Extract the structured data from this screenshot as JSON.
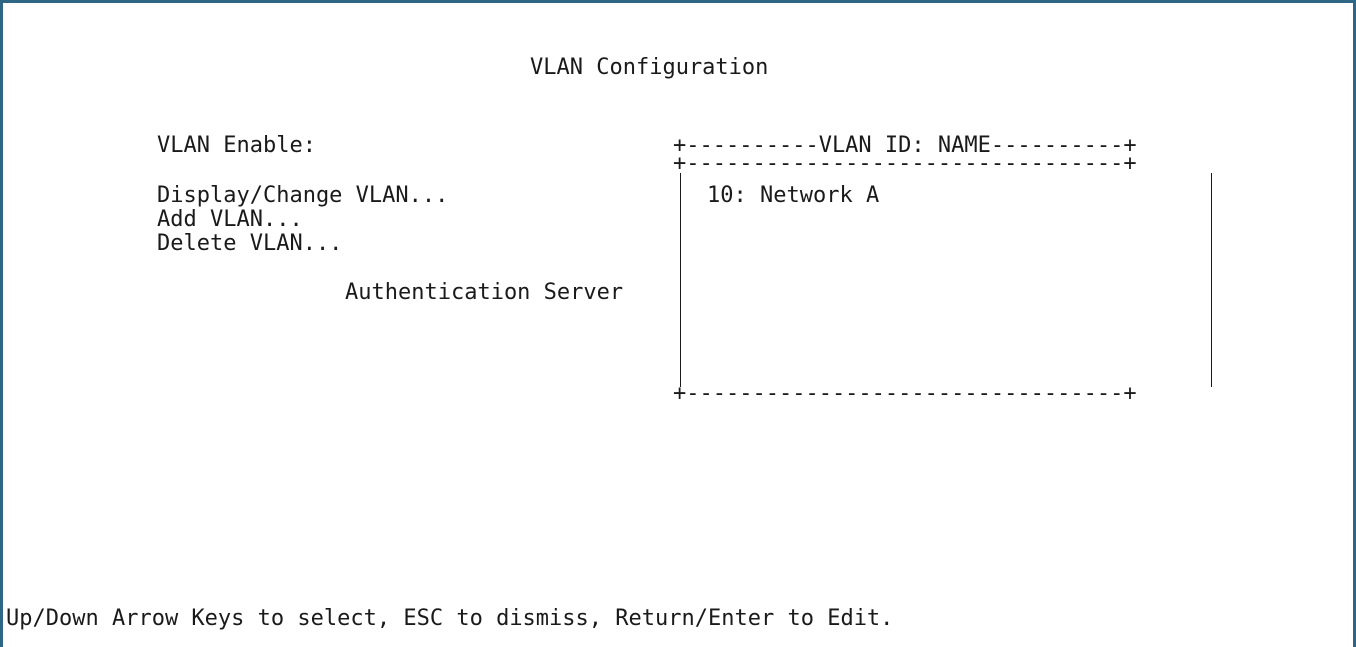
{
  "title": "VLAN Configuration",
  "fields": {
    "vlan_enable_label": "VLAN Enable:"
  },
  "menu": {
    "display_change": "Display/Change VLAN...",
    "add": "Add VLAN...",
    "delete": "Delete VLAN..."
  },
  "auth_server_label": "Authentication Server",
  "vlan_list": {
    "header": "+----------VLAN ID: NAME----------+",
    "separator": "+---------------------------------+",
    "bottom": "+---------------------------------+",
    "items": [
      {
        "label": "10: Network A"
      }
    ]
  },
  "status_bar": "Up/Down Arrow Keys to select, ESC to dismiss, Return/Enter to Edit.",
  "colors": {
    "window_border": "#2f6685",
    "background": "#ffffff",
    "text": "#1a1a1a"
  }
}
